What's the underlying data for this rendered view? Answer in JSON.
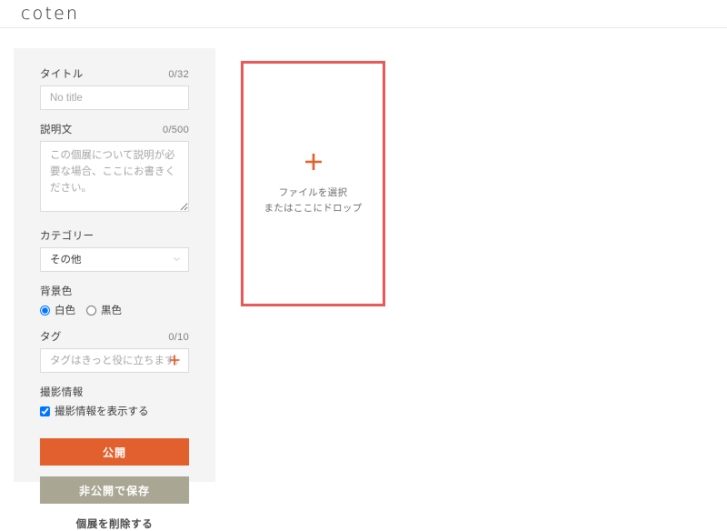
{
  "header": {
    "logo": "coten"
  },
  "sidebar": {
    "title": {
      "label": "タイトル",
      "counter": "0/32",
      "value": "",
      "placeholder": "No title"
    },
    "description": {
      "label": "説明文",
      "counter": "0/500",
      "value": "",
      "placeholder": "この個展について説明が必要な場合、ここにお書きください。"
    },
    "category": {
      "label": "カテゴリー",
      "selected": "その他",
      "options": [
        "その他"
      ]
    },
    "background_color": {
      "label": "背景色",
      "options": [
        {
          "label": "白色",
          "selected": true
        },
        {
          "label": "黒色",
          "selected": false
        }
      ]
    },
    "tag": {
      "label": "タグ",
      "counter": "0/10",
      "value": "",
      "placeholder": "タグはきっと役に立ちます。",
      "add_icon": "plus-icon"
    },
    "shooting_info": {
      "label": "撮影情報",
      "checkbox_label": "撮影情報を表示する",
      "checked": true
    },
    "actions": {
      "publish": "公開",
      "save_private": "非公開で保存",
      "delete": "個展を削除する"
    }
  },
  "dropzone": {
    "icon": "plus-icon",
    "line1": "ファイルを選択",
    "line2": "またはここにドロップ"
  },
  "colors": {
    "accent_orange": "#e2602d",
    "olive": "#a9a693",
    "dropzone_border": "#e85a5a",
    "panel_bg": "#f4f4f4"
  }
}
